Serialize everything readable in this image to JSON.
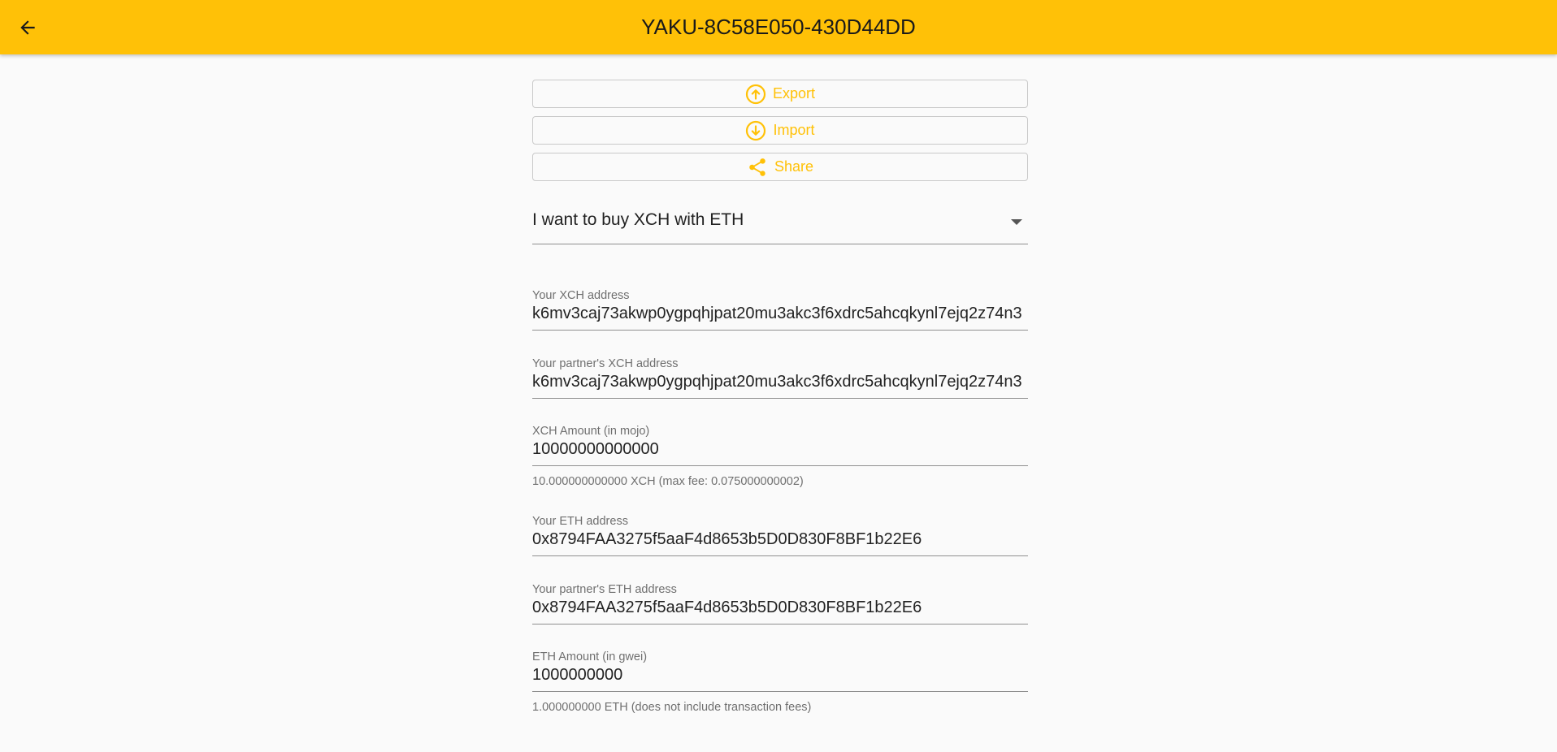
{
  "header": {
    "title": "YAKU-8C58E050-430D44DD",
    "back_icon": "arrow-left-icon"
  },
  "colors": {
    "accent": "#ffc107",
    "background": "#fafafa"
  },
  "actions": {
    "export_label": "Export",
    "export_icon": "circle-arrow-up-icon",
    "import_label": "Import",
    "import_icon": "circle-arrow-down-icon",
    "share_label": "Share",
    "share_icon": "share-icon"
  },
  "trade_mode": {
    "selected": "I want to buy XCH with ETH",
    "icon": "caret-down-icon"
  },
  "fields": {
    "xch_address": {
      "label": "Your XCH address",
      "value": "k6mv3caj73akwp0ygpqhjpat20mu3akc3f6xdrc5ahcqkynl7ejq2z74n3"
    },
    "partner_xch_address": {
      "label": "Your partner's XCH address",
      "value": "k6mv3caj73akwp0ygpqhjpat20mu3akc3f6xdrc5ahcqkynl7ejq2z74n3"
    },
    "xch_amount": {
      "label": "XCH Amount (in mojo)",
      "value": "10000000000000",
      "helper": "10.000000000000 XCH (max fee: 0.075000000002)"
    },
    "eth_address": {
      "label": "Your ETH address",
      "value": "0x8794FAA3275f5aaF4d8653b5D0D830F8BF1b22E6"
    },
    "partner_eth_address": {
      "label": "Your partner's ETH address",
      "value": "0x8794FAA3275f5aaF4d8653b5D0D830F8BF1b22E6"
    },
    "eth_amount": {
      "label": "ETH Amount (in gwei)",
      "value": "1000000000",
      "helper": "1.000000000 ETH (does not include transaction fees)"
    }
  }
}
